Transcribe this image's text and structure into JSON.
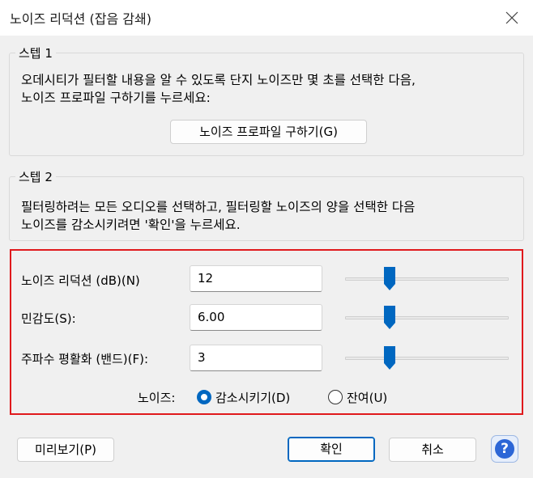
{
  "window": {
    "title": "노이즈 리덕션 (잡음 감쇄)"
  },
  "step1": {
    "legend": "스텝 1",
    "line1": "오데시티가 필터할 내용을 알 수 있도록 단지 노이즈만 몇 초를 선택한 다음,",
    "line2": "노이즈 프로파일 구하기를 누르세요:",
    "button": "노이즈 프로파일 구하기(G)"
  },
  "step2": {
    "legend": "스텝 2",
    "line1": "필터링하려는 모든 오디오를 선택하고, 필터링할 노이즈의 양을 선택한 다음",
    "line2": "노이즈를 감소시키려면 '확인'을 누르세요."
  },
  "params": [
    {
      "label": "노이즈 리덕션 (dB)(N)",
      "value": "12",
      "slider_fraction": 0.27
    },
    {
      "label": "민감도(S):",
      "value": "6.00",
      "slider_fraction": 0.27
    },
    {
      "label": "주파수 평활화 (밴드)(F):",
      "value": "3",
      "slider_fraction": 0.27
    }
  ],
  "noise": {
    "label": "노이즈:",
    "options": [
      {
        "label": "감소시키기(D)",
        "selected": true
      },
      {
        "label": "잔여(U)",
        "selected": false
      }
    ]
  },
  "footer": {
    "preview": "미리보기(P)",
    "ok": "확인",
    "cancel": "취소",
    "help": "?"
  },
  "colors": {
    "accent": "#0067c0",
    "highlight_box": "#e0191c",
    "help": "#2c66d6"
  },
  "icons": {
    "close": "close-icon",
    "help": "help-icon"
  }
}
